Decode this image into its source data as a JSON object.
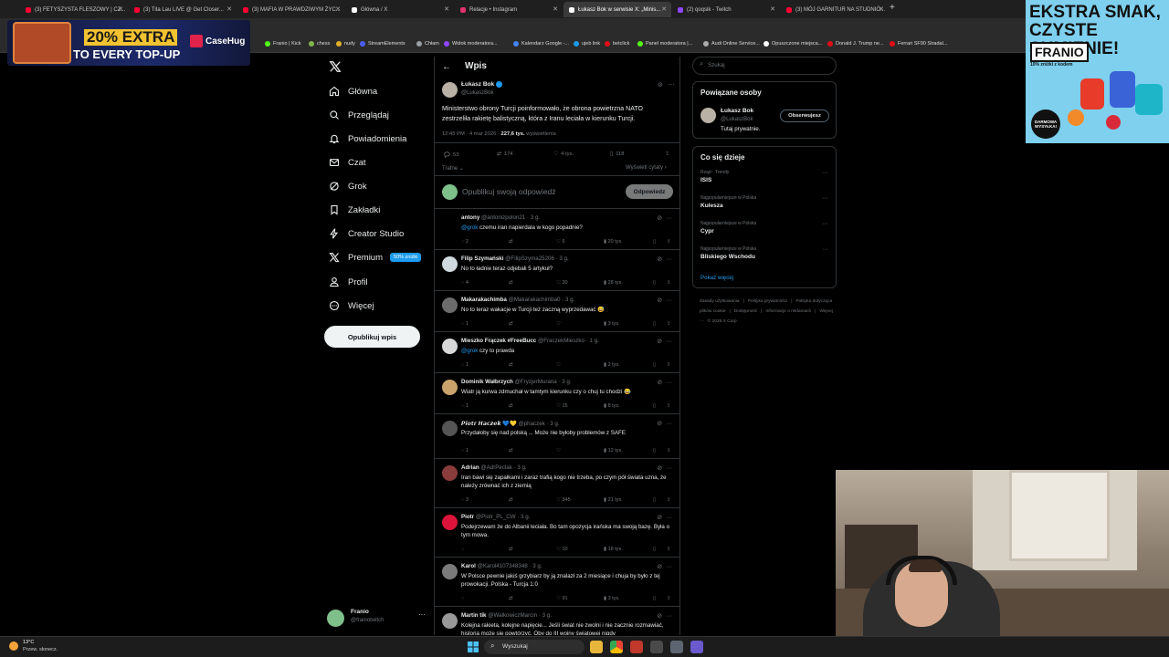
{
  "browser": {
    "tabs": [
      {
        "label": "(3) FETYSZYSTA FLESZOWY | CZ...",
        "color": "#ff0033"
      },
      {
        "label": "(3) Tita Lau LIVE @ Get Closer...",
        "color": "#ff0033"
      },
      {
        "label": "(3) MAFIA W PRAWDZIWYM ŻYC...",
        "color": "#ff0033"
      },
      {
        "label": "Główna / X",
        "color": "#ffffff"
      },
      {
        "label": "Relacje • Instagram",
        "color": "#e1306c"
      },
      {
        "label": "Łukasz Bok w serwisie X: „Minis...",
        "color": "#ffffff"
      },
      {
        "label": "(2) qoqsik - Twitch",
        "color": "#9146ff"
      },
      {
        "label": "(3) MÓJ GARNITUR NA STUDNIÓ...",
        "color": "#ff0033"
      }
    ],
    "new_tab": "+",
    "bookmarks": [
      {
        "label": "Franio | Kick",
        "color": "#53fc18"
      },
      {
        "label": "chess",
        "color": "#81b64c"
      },
      {
        "label": "nudy",
        "color": "#e0b02a"
      },
      {
        "label": "StreamElements",
        "color": "#4a5dff"
      },
      {
        "label": "Chłam",
        "color": "#9aa0a6"
      },
      {
        "label": "Widok moderatora...",
        "color": "#9146ff"
      },
      {
        "label": "Kalendarz Google -...",
        "color": "#4285f4"
      },
      {
        "label": "ujeb link",
        "color": "#1d9bf0"
      },
      {
        "label": "betclick",
        "color": "#e10e17"
      },
      {
        "label": "Panel moderatora |...",
        "color": "#53fc18"
      },
      {
        "label": "Audi Online Service...",
        "color": "#aaaaaa"
      },
      {
        "label": "Opuszczone miejsca...",
        "color": "#ffffff"
      },
      {
        "label": "Donald J. Trump ne...",
        "color": "#e10e17"
      },
      {
        "label": "Ferrari SF90 Stradal...",
        "color": "#e10e17"
      }
    ]
  },
  "overlay_ad": {
    "line1": "20% EXTRA",
    "line2": "TO EVERY TOP-UP",
    "brand": "CaseHug"
  },
  "side_ad": {
    "headline": "EKSTRA SMAK, CZYSTE SUMIENIE!",
    "brand": "FRANIO",
    "sub": "10% zniżki z kodem",
    "badge": "DARMOWA WYSYŁKA!"
  },
  "nav": {
    "items": [
      {
        "label": "Główna",
        "icon": "home-icon"
      },
      {
        "label": "Przeglądaj",
        "icon": "search-icon"
      },
      {
        "label": "Powiadomienia",
        "icon": "bell-icon"
      },
      {
        "label": "Czat",
        "icon": "mail-icon"
      },
      {
        "label": "Grok",
        "icon": "grok-icon"
      },
      {
        "label": "Zakładki",
        "icon": "bookmark-icon"
      },
      {
        "label": "Creator Studio",
        "icon": "lightning-icon"
      },
      {
        "label": "Premium",
        "icon": "x-icon"
      },
      {
        "label": "Profil",
        "icon": "user-icon"
      },
      {
        "label": "Więcej",
        "icon": "more-icon"
      }
    ],
    "premium_badge": "50% zniżki",
    "post_button": "Opublikuj wpis",
    "account": {
      "name": "Franio",
      "handle": "@franiotwitch"
    }
  },
  "post": {
    "header": "Wpis",
    "author": "Łukasz Bok",
    "handle": "@LukaszBok",
    "text": "Ministerstwo obrony Turcji poinformowało, że obrona powietrzna NATO zestrzeliła rakietę balistyczną, która z Iranu leciała w kierunku Turcji.",
    "time": "12:45 PM · 4 mar 2026 ·",
    "views": "227,6 tys.",
    "views_label": "wyświetlenia",
    "stats": {
      "replies": "53",
      "reposts": "174",
      "likes": "4 tys.",
      "bookmarks": "118"
    },
    "sort": "Trafne",
    "quotes": "Wyświetl cytaty",
    "reply_placeholder": "Opublikuj swoją odpowiedź",
    "reply_button": "Odpowiedz"
  },
  "replies": [
    {
      "name": "antony",
      "handle": "@antonizpolon21 · 3 g.",
      "text": "@grok czemu iran napierdala w kogo popadnie?",
      "mention": true,
      "r": "2",
      "rt": "",
      "l": "6",
      "v": "20 tys.",
      "avatar": "#000000"
    },
    {
      "name": "Filip Szymański",
      "handle": "@FilipSzyma25206 · 3 g.",
      "text": "No to ładnie teraz odjebali 5 artykuł?",
      "mention": false,
      "r": "4",
      "rt": "",
      "l": "30",
      "v": "28 tys.",
      "avatar": "#cfd9de"
    },
    {
      "name": "Makarakachimba",
      "handle": "@Makarakachimba0 · 3 g.",
      "text": "No to teraz wakacje w Turcji też zaczną wyprzedawać 😅",
      "mention": false,
      "r": "1",
      "rt": "",
      "l": "",
      "v": "3 tys.",
      "avatar": "#6b6b6b"
    },
    {
      "name": "Mieszko Frączek #FreeBucc",
      "handle": "@FraczekMieszko · 1 g.",
      "text": "@grok czy to prawda",
      "mention": true,
      "r": "1",
      "rt": "",
      "l": "",
      "v": "2 tys.",
      "avatar": "#d8d8d8"
    },
    {
      "name": "Dominik Wałbrzych",
      "handle": "@FryzjerMurana · 3 g.",
      "text": "Wiatr ją kurwa zdmuchał w tamtym kierunku czy o chuj tu chodzi 😂",
      "mention": false,
      "r": "1",
      "rt": "",
      "l": "15",
      "v": "8 tys.",
      "avatar": "#c9a36b"
    },
    {
      "name": "𝙋𝙞𝙤𝙩𝙧 𝙃𝙖𝙘𝙯𝙚𝙠 💙💛",
      "handle": "@phaczek · 3 g.",
      "text": "Przydałoby się nad polską ... Może nie byłoby problemów z SAFE",
      "mention": false,
      "r": "1",
      "rt": "",
      "l": "",
      "v": "12 tys.",
      "avatar": "#555555"
    },
    {
      "name": "Adrian",
      "handle": "@AdrPeclak · 3 g.",
      "text": "Iran bawi się zapałkami i zaraz trafią kogo nie trzeba, po czym pół świata uzna, że należy zrównać ich z ziemią",
      "mention": false,
      "r": "3",
      "rt": "",
      "l": "345",
      "v": "21 tys.",
      "avatar": "#8a3b3b"
    },
    {
      "name": "Piotr",
      "handle": "@Piotr_PL_CW · 3 g.",
      "text": "Podejrzewam że do Albanii leciała. Bo tam opozycja irańska ma swoją bazę. Była o tym mowa.",
      "mention": false,
      "r": "",
      "rt": "",
      "l": "10",
      "v": "18 tys.",
      "avatar": "#dc143c"
    },
    {
      "name": "Karol",
      "handle": "@Karol41073483​48 · 3 g.",
      "text": "W Polsce pewnie jakiś grzybiarz by ją znalazł za 2 miesiące i chuja by było z tej prowokacji. Polska - Turcja 1:0",
      "mention": false,
      "r": "",
      "rt": "",
      "l": "91",
      "v": "3 tys.",
      "avatar": "#7a7a7a"
    },
    {
      "name": "Martin tik",
      "handle": "@WalkowiczMarcin · 3 g.",
      "text": "Kolejna rakieta, kolejne napięcie... Jeśli świat nie zwolni i nie zacznie rozmawiać, historia może się powtórzyć. Oby do III wojny światowej nigdy",
      "mention": false,
      "r": "",
      "rt": "",
      "l": "",
      "v": "",
      "avatar": "#999999"
    }
  ],
  "right": {
    "search_placeholder": "Szukaj",
    "people_title": "Powiązane osoby",
    "person": {
      "name": "Łukasz Bok",
      "handle": "@LukaszBok",
      "bio": "Tutaj prywatnie.",
      "follow": "Obserwujesz"
    },
    "trends_title": "Co się dzieje",
    "trends": [
      {
        "meta": "Rząd · Trendy",
        "name": "ISIS"
      },
      {
        "meta": "Najpopularniejsze w Polska",
        "name": "Kulesza"
      },
      {
        "meta": "Najpopularniejsze w Polska",
        "name": "Cypr"
      },
      {
        "meta": "Najpopularniejsze w Polska",
        "name": "Bliskiego Wschodu"
      }
    ],
    "show_more": "Pokaż więcej",
    "footer": [
      "Zasady użytkowania",
      "|",
      "Polityka prywatności",
      "|",
      "Polityka dotycząca plików cookie",
      "|",
      "Dostępność",
      "|",
      "Informacje o reklamach",
      "|",
      "Więcej ···",
      "© 2026 X Corp."
    ]
  },
  "taskbar": {
    "weather_temp": "13°C",
    "weather_desc": "Przew. słonecz.",
    "search": "Wyszukaj"
  }
}
